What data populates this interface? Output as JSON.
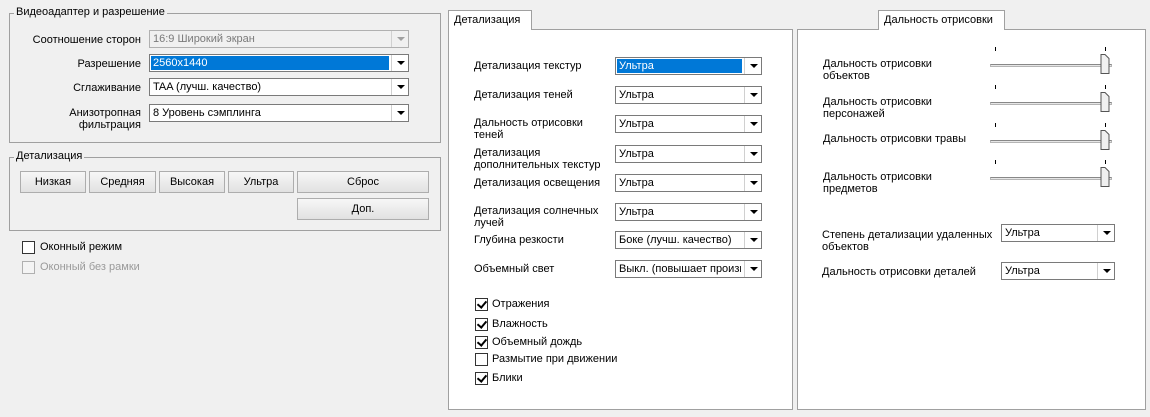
{
  "video_group": {
    "title": "Видеоадаптер и разрешение",
    "aspect_label": "Соотношение сторон",
    "aspect_value": "16:9 Широкий экран",
    "resolution_label": "Разрешение",
    "resolution_value": "2560x1440",
    "aa_label": "Сглаживание",
    "aa_value": "TAA (лучш. качество)",
    "aniso_label": "Анизотропная\nфильтрация",
    "aniso_value": "8 Уровень сэмплинга"
  },
  "detail_group": {
    "title": "Детализация",
    "low": "Низкая",
    "medium": "Средняя",
    "high": "Высокая",
    "ultra": "Ультра",
    "reset": "Сброс",
    "extra": "Доп."
  },
  "window_options": {
    "windowed": "Оконный режим",
    "borderless": "Оконный без рамки"
  },
  "detail_tab": {
    "tab_label": "Детализация",
    "rows": [
      {
        "label": "Детализация текстур",
        "value": "Ультра"
      },
      {
        "label": "Детализация теней",
        "value": "Ультра"
      },
      {
        "label": "Дальность отрисовки\nтеней",
        "value": "Ультра"
      },
      {
        "label": "Детализация\nдополнительных текстур",
        "value": "Ультра"
      },
      {
        "label": "Детализация освещения",
        "value": "Ультра"
      },
      {
        "label": "Детализация солнечных\nлучей",
        "value": "Ультра"
      },
      {
        "label": "Глубина резкости",
        "value": "Боке (лучш. качество)"
      },
      {
        "label": "Объемный свет",
        "value": "Выкл. (повышает произв"
      }
    ],
    "checks": [
      {
        "label": "Отражения",
        "checked": true
      },
      {
        "label": "Влажность",
        "checked": true
      },
      {
        "label": "Объемный дождь",
        "checked": true
      },
      {
        "label": "Размытие при движении",
        "checked": false
      },
      {
        "label": "Блики",
        "checked": true
      }
    ]
  },
  "draw_tab": {
    "tab_label": "Дальность отрисовки",
    "sliders": [
      {
        "label": "Дальность отрисовки\nобъектов",
        "level": 1.0
      },
      {
        "label": "Дальность отрисовки\nперсонажей",
        "level": 1.0
      },
      {
        "label": "Дальность отрисовки травы",
        "level": 1.0
      },
      {
        "label": "Дальность отрисовки\nпредметов",
        "level": 1.0
      }
    ],
    "far_detail_label": "Степень детализации удаленных\nобъектов",
    "far_detail_value": "Ультра",
    "detail_distance_label": "Дальность отрисовки деталей",
    "detail_distance_value": "Ультра"
  }
}
